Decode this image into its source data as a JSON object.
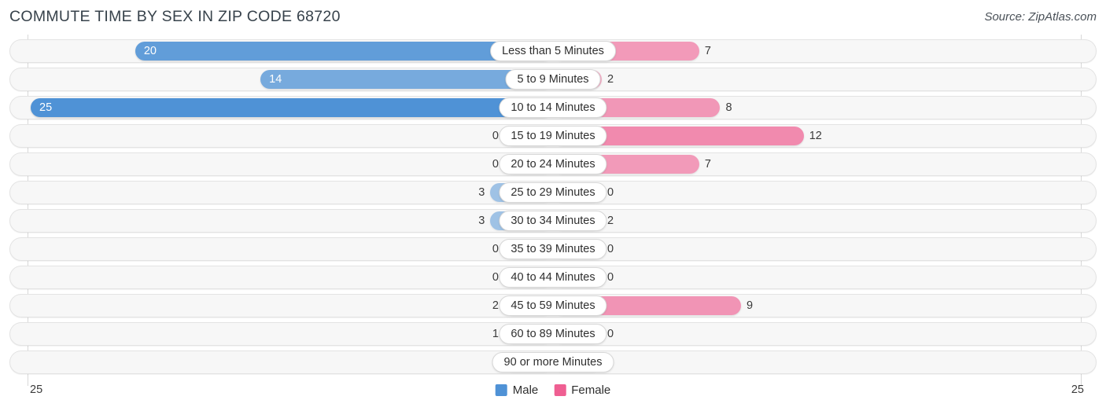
{
  "header": {
    "title": "COMMUTE TIME BY SEX IN ZIP CODE 68720",
    "source": "Source: ZipAtlas.com"
  },
  "legend": {
    "male_label": "Male",
    "female_label": "Female",
    "male_color": "#4f92d6",
    "female_color": "#ef5f92"
  },
  "axis": {
    "left_max_label": "25",
    "right_max_label": "25"
  },
  "chart_data": {
    "type": "bar",
    "title": "COMMUTE TIME BY SEX IN ZIP CODE 68720",
    "subtitle": "Source: ZipAtlas.com",
    "orientation": "horizontal-diverging",
    "xlabel": "",
    "ylabel": "",
    "xlim": [
      25,
      25
    ],
    "axis_max": 25,
    "grid": false,
    "legend_position": "bottom-center",
    "categories": [
      "Less than 5 Minutes",
      "5 to 9 Minutes",
      "10 to 14 Minutes",
      "15 to 19 Minutes",
      "20 to 24 Minutes",
      "25 to 29 Minutes",
      "30 to 34 Minutes",
      "35 to 39 Minutes",
      "40 to 44 Minutes",
      "45 to 59 Minutes",
      "60 to 89 Minutes",
      "90 or more Minutes"
    ],
    "series": [
      {
        "name": "Male",
        "color": "#4f92d6",
        "values": [
          20,
          14,
          25,
          0,
          0,
          3,
          3,
          0,
          0,
          2,
          1,
          0
        ]
      },
      {
        "name": "Female",
        "color": "#ef5f92",
        "values": [
          7,
          2,
          8,
          12,
          7,
          0,
          2,
          0,
          0,
          9,
          0,
          0
        ]
      }
    ],
    "rows": [
      {
        "label": "Less than 5 Minutes",
        "male": 20,
        "female": 7
      },
      {
        "label": "5 to 9 Minutes",
        "male": 14,
        "female": 2
      },
      {
        "label": "10 to 14 Minutes",
        "male": 25,
        "female": 8
      },
      {
        "label": "15 to 19 Minutes",
        "male": 0,
        "female": 12
      },
      {
        "label": "20 to 24 Minutes",
        "male": 0,
        "female": 7
      },
      {
        "label": "25 to 29 Minutes",
        "male": 3,
        "female": 0
      },
      {
        "label": "30 to 34 Minutes",
        "male": 3,
        "female": 2
      },
      {
        "label": "35 to 39 Minutes",
        "male": 0,
        "female": 0
      },
      {
        "label": "40 to 44 Minutes",
        "male": 0,
        "female": 0
      },
      {
        "label": "45 to 59 Minutes",
        "male": 2,
        "female": 9
      },
      {
        "label": "60 to 89 Minutes",
        "male": 1,
        "female": 0
      },
      {
        "label": "90 or more Minutes",
        "male": 0,
        "female": 0
      }
    ]
  }
}
